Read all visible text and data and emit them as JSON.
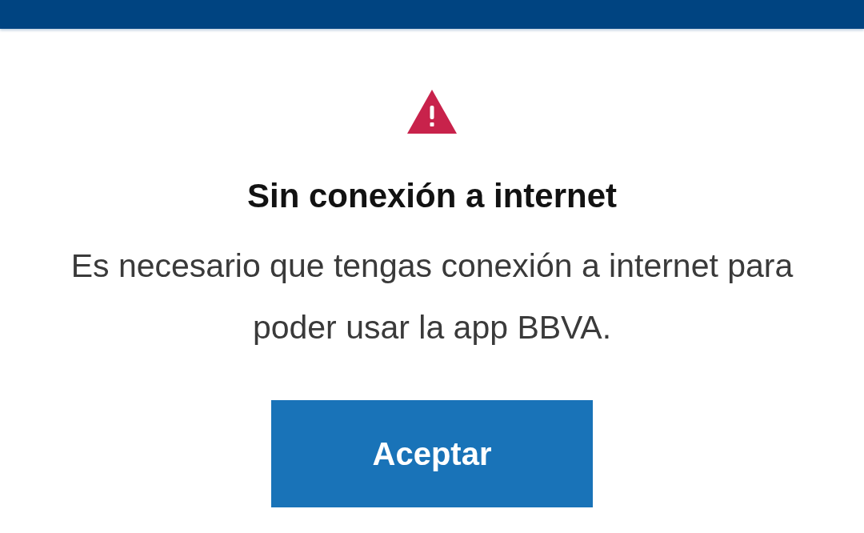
{
  "dialog": {
    "title": "Sin conexión a internet",
    "message": "Es necesario que tengas conexión a internet para poder usar la app BBVA.",
    "button": {
      "label": "Aceptar"
    }
  }
}
